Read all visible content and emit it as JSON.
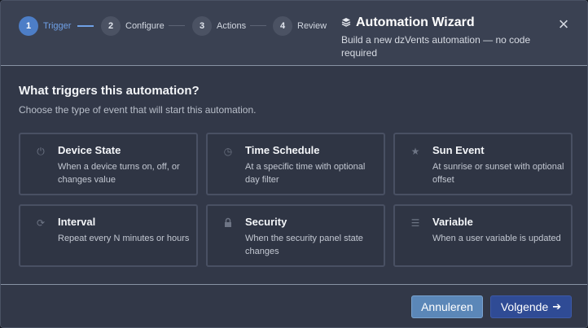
{
  "wizard": {
    "steps": [
      {
        "number": "1",
        "label": "Trigger",
        "active": true
      },
      {
        "number": "2",
        "label": "Configure",
        "active": false
      },
      {
        "number": "3",
        "label": "Actions",
        "active": false
      },
      {
        "number": "4",
        "label": "Review",
        "active": false
      }
    ],
    "title_icon": "layers-icon",
    "title": "Automation Wizard",
    "subtitle": "Build a new dzVents automation — no code required",
    "close_label": "×"
  },
  "body": {
    "question": "What triggers this automation?",
    "hint": "Choose the type of event that will start this automation.",
    "cards": [
      {
        "icon": "power-icon",
        "glyph": "⏻",
        "title": "Device State",
        "description": "When a device turns on, off, or changes value"
      },
      {
        "icon": "clock-icon",
        "glyph": "◷",
        "title": "Time Schedule",
        "description": "At a specific time with optional day filter"
      },
      {
        "icon": "star-icon",
        "glyph": "★",
        "title": "Sun Event",
        "description": "At sunrise or sunset with optional offset"
      },
      {
        "icon": "refresh-icon",
        "glyph": "⟳",
        "title": "Interval",
        "description": "Repeat every N minutes or hours"
      },
      {
        "icon": "lock-icon",
        "glyph": "🔒",
        "title": "Security",
        "description": "When the security panel state changes"
      },
      {
        "icon": "list-icon",
        "glyph": "☰",
        "title": "Variable",
        "description": "When a user variable is updated"
      }
    ]
  },
  "footer": {
    "cancel_label": "Annuleren",
    "next_label": "Volgende",
    "next_arrow": "➔"
  },
  "colors": {
    "accent": "#4d7ec7",
    "cancel_button": "#5b87b8",
    "next_button": "#2f4b95"
  }
}
